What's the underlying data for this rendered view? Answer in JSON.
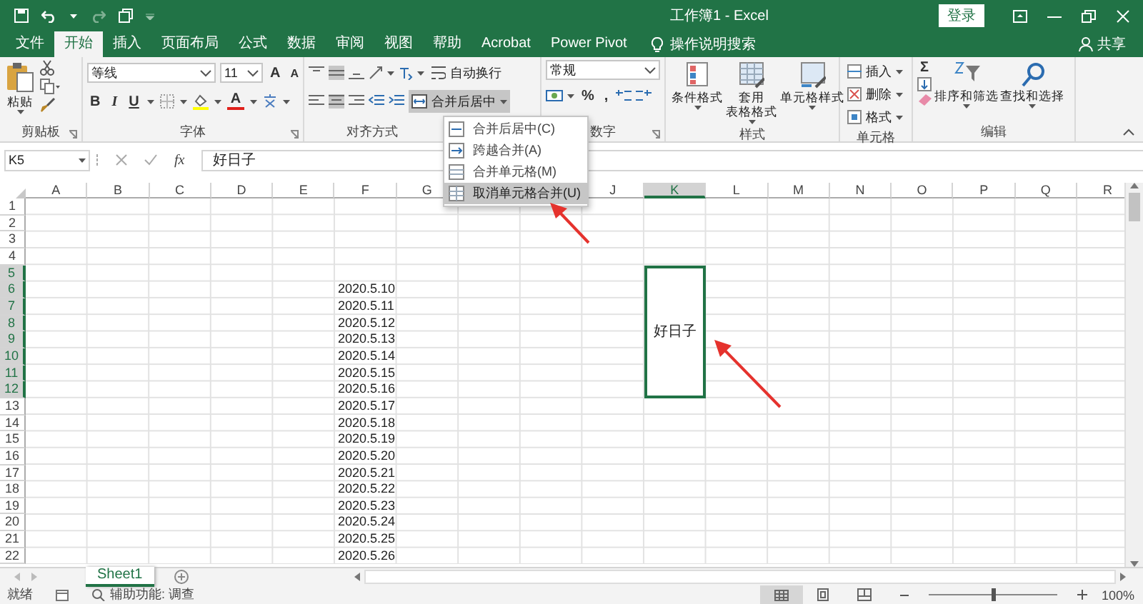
{
  "title_bar": {
    "title": "工作簿1 - Excel",
    "sign_in": "登录"
  },
  "menu_tabs": [
    {
      "label": "文件",
      "selected": false
    },
    {
      "label": "开始",
      "selected": true
    },
    {
      "label": "插入",
      "selected": false
    },
    {
      "label": "页面布局",
      "selected": false
    },
    {
      "label": "公式",
      "selected": false
    },
    {
      "label": "数据",
      "selected": false
    },
    {
      "label": "审阅",
      "selected": false
    },
    {
      "label": "视图",
      "selected": false
    },
    {
      "label": "帮助",
      "selected": false
    },
    {
      "label": "Acrobat",
      "selected": false
    },
    {
      "label": "Power Pivot",
      "selected": false
    }
  ],
  "tell_me": "操作说明搜索",
  "share": "共享",
  "ribbon": {
    "clipboard": {
      "paste": "粘贴",
      "label": "剪贴板"
    },
    "font": {
      "font_name": "等线",
      "font_size": "11",
      "grow": "A",
      "shrink": "A",
      "bold": "B",
      "italic": "I",
      "underline": "U",
      "font_color": "A",
      "label": "字体"
    },
    "alignment": {
      "wrap_text": "自动换行",
      "merge_center": {
        "label": "合并后居中",
        "expanded": true
      },
      "label": "对齐方式"
    },
    "number": {
      "format": "常规",
      "percent": "%",
      "comma": ",",
      "label": "数字"
    },
    "styles": {
      "buttons": [
        {
          "lines": [
            "条件格式"
          ]
        },
        {
          "lines": [
            "套用",
            "表格格式"
          ]
        },
        {
          "lines": [
            "单元格样式"
          ]
        }
      ],
      "label": "样式"
    },
    "cells": {
      "buttons": [
        "插入",
        "删除",
        "格式"
      ],
      "label": "单元格"
    },
    "editing": {
      "sum": "Σ",
      "buttons": [
        "排序和筛选",
        "查找和选择"
      ],
      "label": "编辑"
    }
  },
  "merge_menu": [
    {
      "label": "合并后居中(C)",
      "selected": false
    },
    {
      "label": "跨越合并(A)",
      "selected": false
    },
    {
      "label": "合并单元格(M)",
      "selected": false
    },
    {
      "label": "取消单元格合并(U)",
      "selected": true
    }
  ],
  "formula_bar": {
    "name_box": "K5",
    "fx": "fx",
    "formula": "好日子"
  },
  "grid": {
    "columns": [
      {
        "label": "A",
        "selected": false
      },
      {
        "label": "B",
        "selected": false
      },
      {
        "label": "C",
        "selected": false
      },
      {
        "label": "D",
        "selected": false
      },
      {
        "label": "E",
        "selected": false
      },
      {
        "label": "F",
        "selected": false
      },
      {
        "label": "G",
        "selected": false
      },
      null,
      null,
      {
        "label": "J",
        "selected": false
      },
      {
        "label": "K",
        "selected": true
      },
      {
        "label": "L",
        "selected": false
      },
      {
        "label": "M",
        "selected": false
      },
      {
        "label": "N",
        "selected": false
      },
      {
        "label": "O",
        "selected": false
      },
      {
        "label": "P",
        "selected": false
      },
      {
        "label": "Q",
        "selected": false
      },
      {
        "label": "R",
        "selected": false
      }
    ],
    "rows": [
      {
        "label": "1",
        "selected": false
      },
      {
        "label": "2",
        "selected": false
      },
      {
        "label": "3",
        "selected": false
      },
      {
        "label": "4",
        "selected": false
      },
      {
        "label": "5",
        "selected": true,
        "column_k": {
          "text": "好日子",
          "selected": true,
          "merged": true
        }
      },
      {
        "label": "6",
        "selected": true,
        "column_f": "2020.5.10"
      },
      {
        "label": "7",
        "selected": true,
        "column_f": "2020.5.11"
      },
      {
        "label": "8",
        "selected": true,
        "column_f": "2020.5.12"
      },
      {
        "label": "9",
        "selected": true,
        "column_f": "2020.5.13"
      },
      {
        "label": "10",
        "selected": true,
        "column_f": "2020.5.14"
      },
      {
        "label": "11",
        "selected": true,
        "column_f": "2020.5.15"
      },
      {
        "label": "12",
        "selected": true,
        "column_f": "2020.5.16"
      },
      {
        "label": "13",
        "selected": false,
        "column_f": "2020.5.17"
      },
      {
        "label": "14",
        "selected": false,
        "column_f": "2020.5.18"
      },
      {
        "label": "15",
        "selected": false,
        "column_f": "2020.5.19"
      },
      {
        "label": "16",
        "selected": false,
        "column_f": "2020.5.20"
      },
      {
        "label": "17",
        "selected": false,
        "column_f": "2020.5.21"
      },
      {
        "label": "18",
        "selected": false,
        "column_f": "2020.5.22"
      },
      {
        "label": "19",
        "selected": false,
        "column_f": "2020.5.23"
      },
      {
        "label": "20",
        "selected": false,
        "column_f": "2020.5.24"
      },
      {
        "label": "21",
        "selected": false,
        "column_f": "2020.5.25"
      },
      {
        "label": "22",
        "selected": false,
        "column_f": "2020.5.26"
      }
    ]
  },
  "sheet_tabs": [
    {
      "label": "Sheet1",
      "selected": true
    }
  ],
  "status_bar": {
    "ready": "就绪",
    "accessibility": "辅助功能: 调查",
    "zoom": "100%",
    "zoom_slider": {
      "level": 0.5
    }
  }
}
